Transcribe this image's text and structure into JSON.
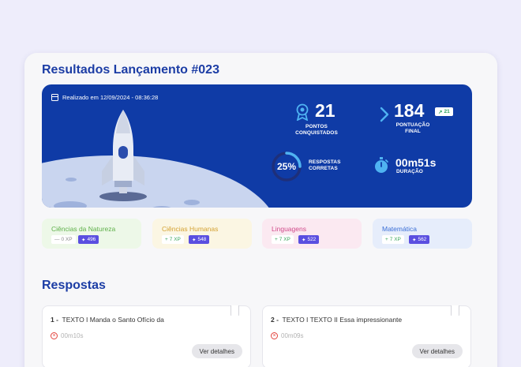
{
  "page_title": "Resultados Lançamento #023",
  "hero": {
    "date": "Realizado em 12/09/2024 - 08:36:28",
    "points_value": "21",
    "points_label_1": "PONTOS",
    "points_label_2": "CONQUISTADOS",
    "score_value": "184",
    "score_label_1": "PONTUAÇÃO",
    "score_label_2": "FINAL",
    "score_delta": "21",
    "correct_percent": "25%",
    "correct_fraction": 0.25,
    "correct_label_1": "RESPOSTAS",
    "correct_label_2": "CORRETAS",
    "duration_value": "00m51s",
    "duration_label": "DURAÇÃO"
  },
  "subjects": [
    {
      "name": "Ciências da Natureza",
      "xp": "0 XP",
      "xp_sign": "—",
      "points": "496"
    },
    {
      "name": "Ciências Humanas",
      "xp": "7 XP",
      "xp_sign": "+",
      "points": "548"
    },
    {
      "name": "Linguagens",
      "xp": "7 XP",
      "xp_sign": "+",
      "points": "522"
    },
    {
      "name": "Matemática",
      "xp": "7 XP",
      "xp_sign": "+",
      "points": "562"
    }
  ],
  "answers_title": "Respostas",
  "answers": [
    {
      "number": "1 -",
      "text": "TEXTO I Manda o Santo Ofício da",
      "time": "00m10s",
      "button": "Ver detalhes"
    },
    {
      "number": "2 -",
      "text": "TEXTO I   TEXTO II Essa impressionante",
      "time": "00m09s",
      "button": "Ver detalhes"
    }
  ],
  "colors": {
    "hero_bg": "#0f3ba6",
    "title": "#1c3da5",
    "subject_natureza": "#edf8e8",
    "subject_humanas": "#fbf6e3",
    "subject_linguagens": "#fbe9f1",
    "subject_matematica": "#e6edfb",
    "points_chip": "#5a4fe0",
    "wrong": "#e3433d"
  },
  "icons": [
    "calendar-icon",
    "medal-icon",
    "chevron-right-icon",
    "trend-up-icon",
    "stopwatch-icon",
    "sparkle-icon",
    "x-circle-icon",
    "bookmark-icon"
  ]
}
